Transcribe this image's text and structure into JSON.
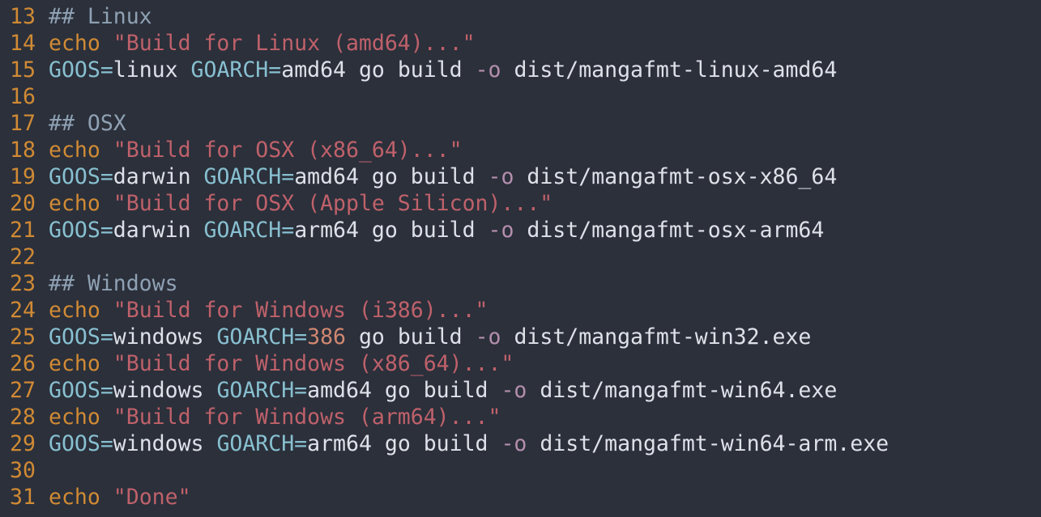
{
  "colors": {
    "background": "#2b303b",
    "line_number": "#d08a34",
    "comment": "#8fa1b3",
    "keyword_echo": "#d08a34",
    "string": "#bf616a",
    "variable": "#88c0d0",
    "plain": "#dfe1e8",
    "flag": "#b48ead",
    "number": "#d08770"
  },
  "lines": [
    {
      "num": "13",
      "tokens": [
        {
          "t": "comment",
          "v": "## Linux"
        }
      ]
    },
    {
      "num": "14",
      "tokens": [
        {
          "t": "echo",
          "v": "echo"
        },
        {
          "t": "plain",
          "v": " "
        },
        {
          "t": "string",
          "v": "\"Build for Linux (amd64)...\""
        }
      ]
    },
    {
      "num": "15",
      "tokens": [
        {
          "t": "var",
          "v": "GOOS"
        },
        {
          "t": "eq",
          "v": "="
        },
        {
          "t": "plain",
          "v": "linux "
        },
        {
          "t": "var",
          "v": "GOARCH"
        },
        {
          "t": "eq",
          "v": "="
        },
        {
          "t": "plain",
          "v": "amd64 go build "
        },
        {
          "t": "flag",
          "v": "-o"
        },
        {
          "t": "plain",
          "v": " dist/mangafmt-linux-amd64"
        }
      ]
    },
    {
      "num": "16",
      "tokens": []
    },
    {
      "num": "17",
      "tokens": [
        {
          "t": "comment",
          "v": "## OSX"
        }
      ]
    },
    {
      "num": "18",
      "tokens": [
        {
          "t": "echo",
          "v": "echo"
        },
        {
          "t": "plain",
          "v": " "
        },
        {
          "t": "string",
          "v": "\"Build for OSX (x86_64)...\""
        }
      ]
    },
    {
      "num": "19",
      "tokens": [
        {
          "t": "var",
          "v": "GOOS"
        },
        {
          "t": "eq",
          "v": "="
        },
        {
          "t": "plain",
          "v": "darwin "
        },
        {
          "t": "var",
          "v": "GOARCH"
        },
        {
          "t": "eq",
          "v": "="
        },
        {
          "t": "plain",
          "v": "amd64 go build "
        },
        {
          "t": "flag",
          "v": "-o"
        },
        {
          "t": "plain",
          "v": " dist/mangafmt-osx-x86_64"
        }
      ]
    },
    {
      "num": "20",
      "tokens": [
        {
          "t": "echo",
          "v": "echo"
        },
        {
          "t": "plain",
          "v": " "
        },
        {
          "t": "string",
          "v": "\"Build for OSX (Apple Silicon)...\""
        }
      ]
    },
    {
      "num": "21",
      "tokens": [
        {
          "t": "var",
          "v": "GOOS"
        },
        {
          "t": "eq",
          "v": "="
        },
        {
          "t": "plain",
          "v": "darwin "
        },
        {
          "t": "var",
          "v": "GOARCH"
        },
        {
          "t": "eq",
          "v": "="
        },
        {
          "t": "plain",
          "v": "arm64 go build "
        },
        {
          "t": "flag",
          "v": "-o"
        },
        {
          "t": "plain",
          "v": " dist/mangafmt-osx-arm64"
        }
      ]
    },
    {
      "num": "22",
      "tokens": []
    },
    {
      "num": "23",
      "tokens": [
        {
          "t": "comment",
          "v": "## Windows"
        }
      ]
    },
    {
      "num": "24",
      "tokens": [
        {
          "t": "echo",
          "v": "echo"
        },
        {
          "t": "plain",
          "v": " "
        },
        {
          "t": "string",
          "v": "\"Build for Windows (i386)...\""
        }
      ]
    },
    {
      "num": "25",
      "tokens": [
        {
          "t": "var",
          "v": "GOOS"
        },
        {
          "t": "eq",
          "v": "="
        },
        {
          "t": "plain",
          "v": "windows "
        },
        {
          "t": "var",
          "v": "GOARCH"
        },
        {
          "t": "eq",
          "v": "="
        },
        {
          "t": "num",
          "v": "386"
        },
        {
          "t": "plain",
          "v": " go build "
        },
        {
          "t": "flag",
          "v": "-o"
        },
        {
          "t": "plain",
          "v": " dist/mangafmt-win32.exe"
        }
      ]
    },
    {
      "num": "26",
      "tokens": [
        {
          "t": "echo",
          "v": "echo"
        },
        {
          "t": "plain",
          "v": " "
        },
        {
          "t": "string",
          "v": "\"Build for Windows (x86_64)...\""
        }
      ]
    },
    {
      "num": "27",
      "tokens": [
        {
          "t": "var",
          "v": "GOOS"
        },
        {
          "t": "eq",
          "v": "="
        },
        {
          "t": "plain",
          "v": "windows "
        },
        {
          "t": "var",
          "v": "GOARCH"
        },
        {
          "t": "eq",
          "v": "="
        },
        {
          "t": "plain",
          "v": "amd64 go build "
        },
        {
          "t": "flag",
          "v": "-o"
        },
        {
          "t": "plain",
          "v": " dist/mangafmt-win64.exe"
        }
      ]
    },
    {
      "num": "28",
      "tokens": [
        {
          "t": "echo",
          "v": "echo"
        },
        {
          "t": "plain",
          "v": " "
        },
        {
          "t": "string",
          "v": "\"Build for Windows (arm64)...\""
        }
      ]
    },
    {
      "num": "29",
      "tokens": [
        {
          "t": "var",
          "v": "GOOS"
        },
        {
          "t": "eq",
          "v": "="
        },
        {
          "t": "plain",
          "v": "windows "
        },
        {
          "t": "var",
          "v": "GOARCH"
        },
        {
          "t": "eq",
          "v": "="
        },
        {
          "t": "plain",
          "v": "arm64 go build "
        },
        {
          "t": "flag",
          "v": "-o"
        },
        {
          "t": "plain",
          "v": " dist/mangafmt-win64-arm.exe"
        }
      ]
    },
    {
      "num": "30",
      "tokens": []
    },
    {
      "num": "31",
      "tokens": [
        {
          "t": "echo",
          "v": "echo"
        },
        {
          "t": "plain",
          "v": " "
        },
        {
          "t": "string",
          "v": "\"Done\""
        }
      ]
    }
  ]
}
